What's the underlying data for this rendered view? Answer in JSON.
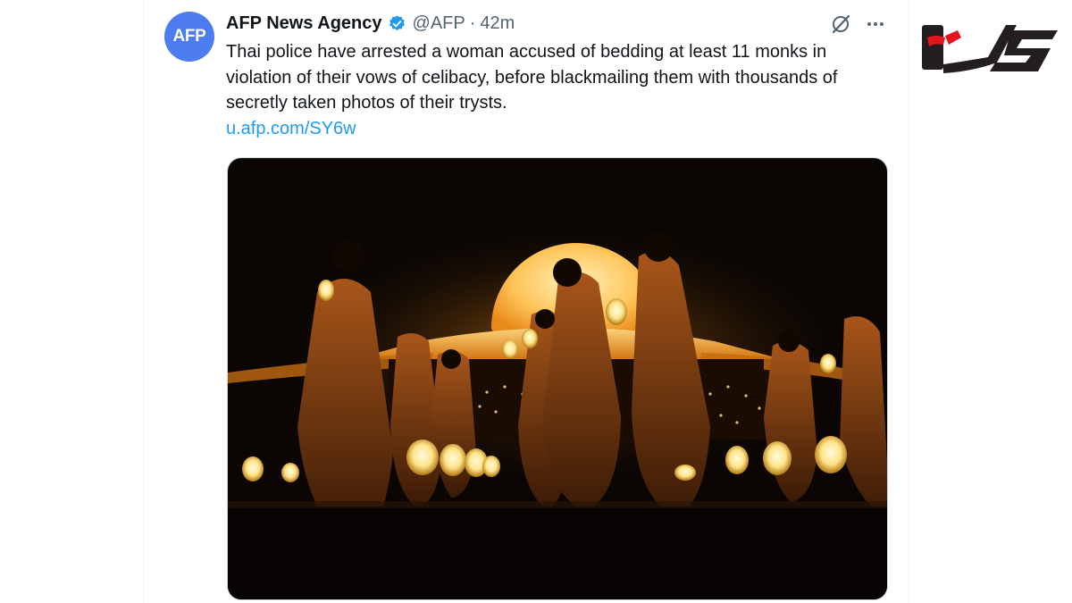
{
  "tweet": {
    "avatar_text": "AFP",
    "display_name": "AFP News Agency",
    "handle": "@AFP",
    "separator": "·",
    "timestamp": "42m",
    "text": "Thai police have arrested a woman accused of bedding at least 11 monks in violation of their vows of celibacy, before blackmailing them with thousands of secretly taken photos of their trysts.",
    "link": "u.afp.com/SY6w"
  },
  "icons": {
    "verified": "verified-badge-icon",
    "grok": "grok-icon",
    "more": "more-icon"
  },
  "colors": {
    "accent_blue": "#1d9bf0",
    "avatar_blue": "#4d7cf0",
    "secondary_text": "#536471",
    "logo_red": "#e3141b",
    "logo_dark": "#231f20"
  }
}
